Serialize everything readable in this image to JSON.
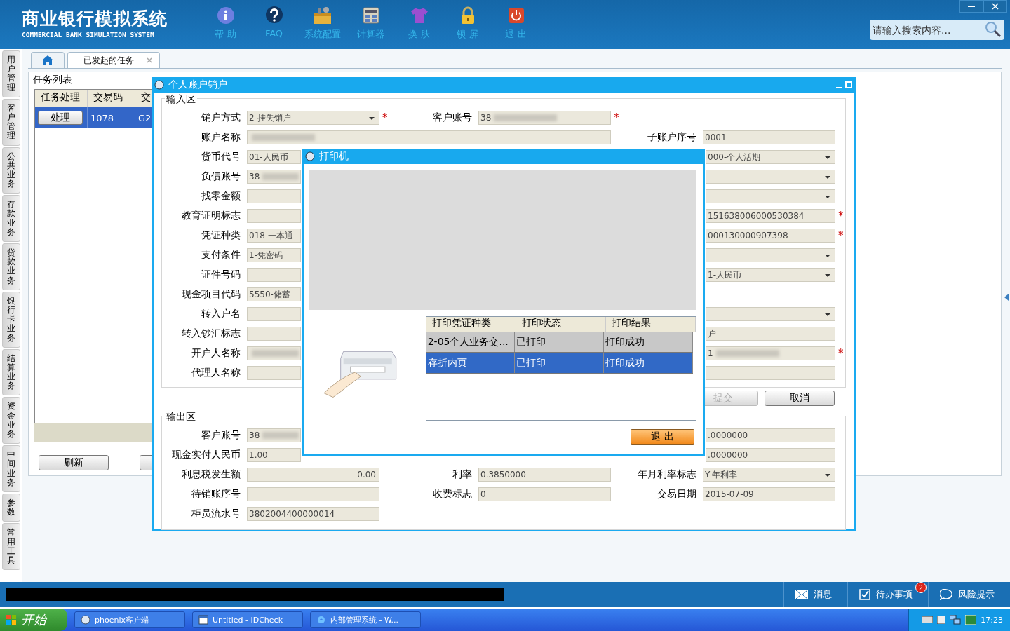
{
  "header": {
    "title": "商业银行模拟系统",
    "subtitle": "COMMERCIAL BANK SIMULATION SYSTEM",
    "tools": [
      {
        "kind": "info",
        "label": "帮 助"
      },
      {
        "kind": "faq",
        "label": "FAQ"
      },
      {
        "kind": "config",
        "label": "系统配置"
      },
      {
        "kind": "calc",
        "label": "计算器"
      },
      {
        "kind": "skin",
        "label": "换 肤"
      },
      {
        "kind": "lock",
        "label": "锁 屏"
      },
      {
        "kind": "exit",
        "label": "退 出"
      }
    ],
    "search": {
      "placeholder": "请输入搜索内容..."
    }
  },
  "tabs": [
    {
      "kind": "home",
      "selected": false
    },
    {
      "kind": "text",
      "label": "已发起的任务",
      "selected": true
    }
  ],
  "sidebar": [
    {
      "label": "用户管理"
    },
    {
      "label": "客户管理"
    },
    {
      "label": "公共业务"
    },
    {
      "label": "存款业务"
    },
    {
      "label": "贷款业务"
    },
    {
      "label": "银行卡业务"
    },
    {
      "label": "结算业务"
    },
    {
      "label": "资金业务"
    },
    {
      "label": "中间业务"
    },
    {
      "label": "参数"
    },
    {
      "label": "常用工具"
    }
  ],
  "task_list": {
    "title": "任务列表",
    "columns": [
      "任务处理",
      "交易码",
      "交"
    ],
    "rows": [
      {
        "action": "处理",
        "code": "1078",
        "column_3": "G2",
        "selected": true
      }
    ],
    "buttons": [
      "刷新"
    ]
  },
  "account_dialog": {
    "title": "个人账户销户",
    "input_section": {
      "title": "输入区",
      "rows": [
        [
          {
            "label": "销户方式",
            "value": "2-挂失销户",
            "kind": "select",
            "mark": "*"
          },
          {
            "label": "客户账号",
            "value": "38",
            "kind": "text",
            "redacted": true,
            "mark": "*"
          },
          null
        ],
        [
          {
            "label": "账户名称",
            "kind": "wide",
            "redacted": true
          },
          null,
          {
            "label": "子账户序号",
            "value": "0001",
            "kind": "text"
          }
        ],
        [
          {
            "label": "货币代号",
            "value": "01-人民币",
            "kind": "text"
          },
          null,
          {
            "value": "000-个人活期",
            "kind": "select"
          }
        ],
        [
          {
            "label": "负债账号",
            "value": "38",
            "kind": "text",
            "redacted": true
          },
          null,
          {
            "kind": "select"
          }
        ],
        [
          {
            "label": "找零金额",
            "kind": "text"
          },
          null,
          {
            "kind": "select"
          }
        ],
        [
          {
            "label": "教育证明标志",
            "kind": "text"
          },
          null,
          {
            "value": "151638006000530384",
            "kind": "text",
            "mark": "*"
          }
        ],
        [
          {
            "label": "凭证种类",
            "value": "018-一本通",
            "kind": "text"
          },
          null,
          {
            "value": "000130000907398",
            "kind": "text",
            "mark": "*"
          }
        ],
        [
          {
            "label": "支付条件",
            "value": "1-凭密码",
            "kind": "text"
          },
          null,
          {
            "kind": "select"
          }
        ],
        [
          {
            "label": "证件号码",
            "kind": "text"
          },
          null,
          {
            "value": "1-人民币",
            "kind": "select"
          }
        ],
        [
          {
            "label": "现金项目代码",
            "value": "5550-储蓄",
            "kind": "text"
          },
          null,
          null
        ],
        [
          {
            "label": "转入户名",
            "kind": "text"
          },
          null,
          {
            "kind": "select"
          }
        ],
        [
          {
            "label": "转入钞汇标志",
            "kind": "text"
          },
          null,
          {
            "value": "户",
            "kind": "text"
          }
        ],
        [
          {
            "label": "开户人名称",
            "kind": "text",
            "redacted": true
          },
          null,
          {
            "value": "1",
            "kind": "text",
            "redacted": true,
            "mark": "*"
          }
        ],
        [
          {
            "label": "代理人名称",
            "kind": "text"
          },
          null,
          {
            "kind": "text"
          }
        ]
      ]
    },
    "buttons": [
      {
        "label": "提交",
        "disabled": true
      },
      {
        "label": "取消",
        "disabled": false
      }
    ],
    "output_section": {
      "title": "输出区",
      "rows": [
        [
          {
            "label": "客户账号",
            "value": "38",
            "kind": "text",
            "redacted": true
          },
          null,
          {
            "value": ".0000000",
            "kind": "text"
          }
        ],
        [
          {
            "label": "现金实付人民币",
            "value": "1.00",
            "kind": "text"
          },
          null,
          {
            "value": ".0000000",
            "kind": "text"
          }
        ],
        [
          {
            "label": "利息税发生额",
            "value": "0.00",
            "kind": "text",
            "right_aligned": true
          },
          {
            "label": "利率",
            "value": "0.3850000",
            "kind": "text"
          },
          {
            "label": "年月利率标志",
            "value": "Y-年利率",
            "kind": "select"
          }
        ],
        [
          {
            "label": "待销账序号",
            "kind": "text"
          },
          {
            "label": "收费标志",
            "value": "0",
            "kind": "text"
          },
          {
            "label": "交易日期",
            "value": "2015-07-09",
            "kind": "text"
          }
        ],
        [
          {
            "label": "柜员流水号",
            "value": "3802004400000014",
            "kind": "text"
          },
          null,
          null
        ]
      ]
    }
  },
  "printer_dialog": {
    "title": "打印机",
    "columns": [
      "打印凭证种类",
      "打印状态",
      "打印结果"
    ],
    "rows": [
      {
        "cells": [
          "2-05个人业务交...",
          "已打印",
          "打印成功"
        ],
        "selected": false
      },
      {
        "cells": [
          "存折内页",
          "已打印",
          "打印成功"
        ],
        "selected": true
      }
    ],
    "button": "退 出"
  },
  "status_bar": {
    "items": [
      {
        "kind": "mail",
        "label": "消息"
      },
      {
        "kind": "check",
        "label": "待办事项",
        "badge": "2"
      },
      {
        "kind": "chat",
        "label": "风险提示"
      }
    ]
  },
  "taskbar": {
    "start": "开始",
    "tasks": [
      {
        "kind": "app",
        "label": "phoenix客户端"
      },
      {
        "kind": "window",
        "label": "Untitled - IDCheck"
      },
      {
        "kind": "browser",
        "label": "内部管理系统 - W..."
      }
    ],
    "clock": "17:23"
  }
}
